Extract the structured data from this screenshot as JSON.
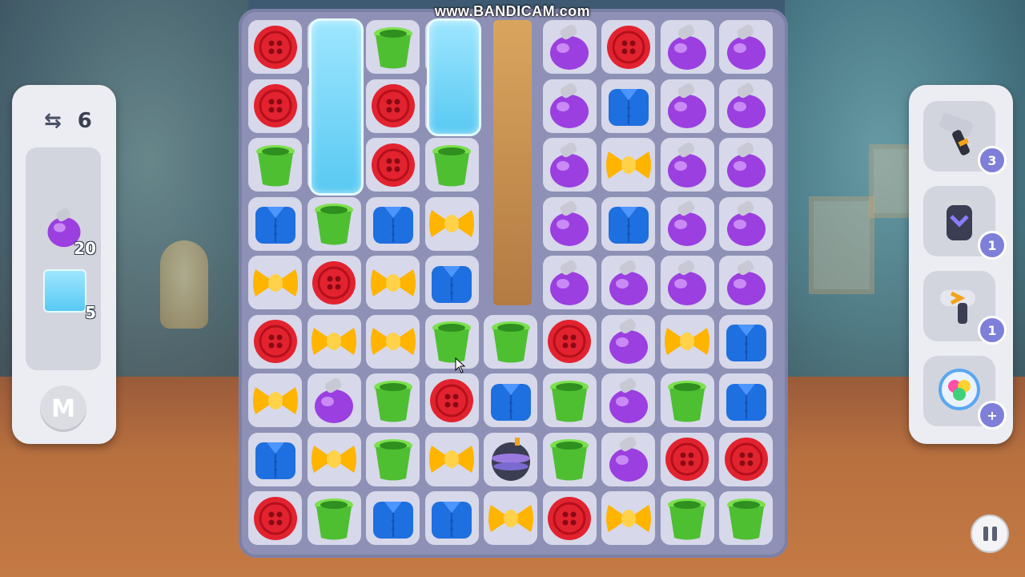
{
  "watermark": "www.BANDICAM.com",
  "moves": {
    "value": "6",
    "icon": "swap-arrows-icon"
  },
  "goals": [
    {
      "piece": "potion",
      "count": "20"
    },
    {
      "piece": "jelly",
      "count": "5"
    }
  ],
  "mode_button": "M",
  "boosters": [
    {
      "name": "hammer",
      "count": "3"
    },
    {
      "name": "trimmer",
      "count": "1"
    },
    {
      "name": "hairdryer",
      "count": "1"
    },
    {
      "name": "shuffle",
      "count": "+"
    }
  ],
  "board": {
    "rows": [
      [
        "button",
        "jelly",
        "cup",
        "jelly",
        "void",
        "potion",
        "button",
        "potion",
        "potion"
      ],
      [
        "button",
        "jelly",
        "button",
        "jelly",
        "void",
        "potion",
        "shirt",
        "potion",
        "potion"
      ],
      [
        "cup",
        "jelly",
        "button",
        "cup",
        "void",
        "potion",
        "bow",
        "potion",
        "potion"
      ],
      [
        "shirt",
        "cup",
        "shirt",
        "bow",
        "void",
        "potion",
        "shirt",
        "potion",
        "potion"
      ],
      [
        "bow",
        "button",
        "bow",
        "shirt",
        "void",
        "potion",
        "potion",
        "potion",
        "potion"
      ],
      [
        "button",
        "bow",
        "bow",
        "cup",
        "cup",
        "button",
        "potion",
        "bow",
        "shirt"
      ],
      [
        "bow",
        "potion",
        "cup",
        "button",
        "shirt",
        "cup",
        "potion",
        "cup",
        "shirt"
      ],
      [
        "shirt",
        "bow",
        "cup",
        "bow",
        "bomb",
        "cup",
        "potion",
        "button",
        "button"
      ],
      [
        "button",
        "cup",
        "shirt",
        "shirt",
        "bow",
        "button",
        "bow",
        "cup",
        "cup"
      ]
    ]
  },
  "colors": {
    "button": "#e2232f",
    "cup": "#4fbf32",
    "shirt": "#1e6fe0",
    "bow": "#ffb400",
    "potion": "#9b3fe0",
    "jelly": "#66d0f5"
  }
}
